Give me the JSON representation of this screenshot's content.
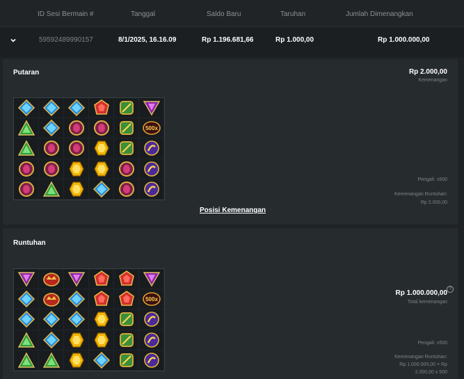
{
  "table": {
    "headers": [
      "ID Sesi Bermain #",
      "Tanggal",
      "Saldo Baru",
      "Taruhan",
      "Jumlah Dimenangkan"
    ],
    "row": {
      "session_id": "59592489990157",
      "date": "8/1/2025, 16.16.09",
      "new_balance": "Rp 1.196.681,66",
      "bet": "Rp 1.000,00",
      "win": "Rp 1.000.000,00"
    }
  },
  "spin_panel": {
    "title": "Putaran",
    "amount": "Rp 2.000,00",
    "amount_label": "Kemenangan",
    "multiplier": "Pengali: x500",
    "cascade_label": "Kemenangan Runtuhan:",
    "cascade_value": "Rp 2.000,00",
    "link": "Posisi Kemenangan",
    "grid": [
      [
        "blue",
        "blue",
        "blue",
        "red",
        "green-gold",
        "purple-tri"
      ],
      [
        "green-tri",
        "blue",
        "ring",
        "ring",
        "green-gold",
        "mult"
      ],
      [
        "green-tri",
        "ring",
        "ring",
        "yellow",
        "green-gold",
        "purple-gold"
      ],
      [
        "ring",
        "ring",
        "yellow",
        "yellow",
        "ring",
        "purple-gold"
      ],
      [
        "ring",
        "green-tri",
        "yellow",
        "blue",
        "ring",
        "purple-gold"
      ]
    ],
    "mult_label": "500x"
  },
  "cascade_panel": {
    "title": "Runtuhan",
    "total": "Rp 1.000.000,00",
    "total_label": "Total kemenangan",
    "help_icon": "?",
    "multiplier": "Pengali: x500",
    "cascade_label": "Kemenangan Runtuhan:",
    "cascade_line1": "Rp 1.000.000,00 = Rp",
    "cascade_line2": "2.000,00 x 500",
    "grid": [
      [
        "purple-tri",
        "crown",
        "purple-tri",
        "red",
        "red",
        "purple-tri"
      ],
      [
        "blue",
        "crown",
        "blue",
        "red",
        "red",
        "mult"
      ],
      [
        "blue",
        "blue",
        "blue",
        "yellow",
        "green-gold",
        "purple-gold"
      ],
      [
        "green-tri",
        "blue",
        "yellow",
        "yellow",
        "green-gold",
        "purple-gold"
      ],
      [
        "green-tri",
        "green-tri",
        "yellow",
        "blue",
        "green-gold",
        "purple-gold"
      ]
    ],
    "mult_label": "500x"
  },
  "colors": {
    "background": "#1f2326",
    "panel": "#262b2e",
    "accent": "#ffffff"
  }
}
